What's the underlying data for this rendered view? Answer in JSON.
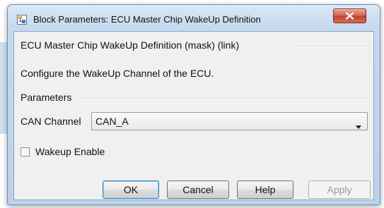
{
  "window": {
    "title": "Block Parameters: ECU Master Chip WakeUp Definition",
    "close_icon": "close-icon"
  },
  "mask": {
    "title": "ECU Master Chip WakeUp Definition (mask) (link)",
    "description": "Configure the WakeUp Channel of the ECU."
  },
  "parameters": {
    "title": "Parameters",
    "can_channel_label": "CAN Channel",
    "can_channel_value": "CAN_A",
    "wakeup_enable_label": "Wakeup Enable",
    "wakeup_enable_checked": false
  },
  "buttons": {
    "ok": "OK",
    "cancel": "Cancel",
    "help": "Help",
    "apply": "Apply"
  },
  "colors": {
    "close_button": "#c1432e",
    "default_button_border": "#3c7fb1",
    "disabled_text": "#9a9a9a"
  }
}
